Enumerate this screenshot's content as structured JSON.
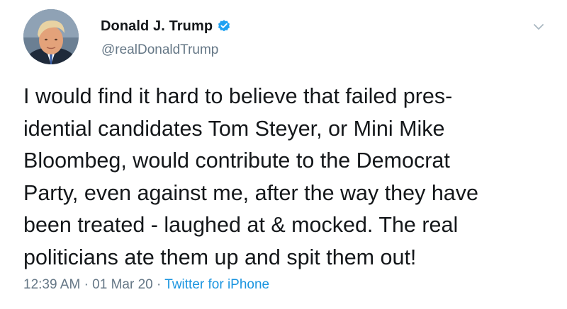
{
  "author": {
    "display_name": "Donald J. Trump",
    "handle": "@realDonaldTrump",
    "verified": true,
    "avatar_icon": "profile-photo"
  },
  "tweet": {
    "lines": [
      "I would find it hard to believe that failed pres-",
      "idential candidates Tom Steyer, or Mini Mike",
      "Bloombeg, would contribute to the Democrat",
      "Party, even against me, after the way they have",
      "been treated - laughed at & mocked. The real",
      "politicians ate them up and spit them out!"
    ]
  },
  "meta": {
    "time": "12:39 AM",
    "separator": "·",
    "date": "01 Mar 20",
    "source": "Twitter for iPhone"
  },
  "icons": {
    "verified": "verified-badge-icon",
    "menu": "chevron-down-icon"
  },
  "colors": {
    "text": "#14171a",
    "secondary": "#657786",
    "link": "#1b95e0",
    "verified": "#1da1f2"
  }
}
